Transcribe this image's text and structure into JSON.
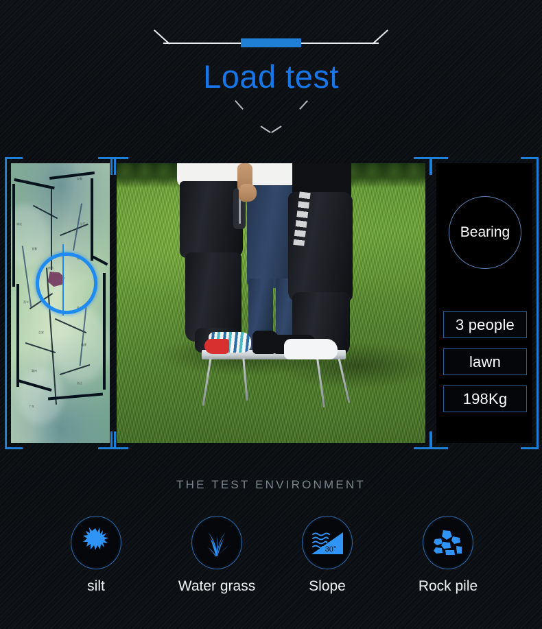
{
  "header": {
    "title": "Load test",
    "accent_color": "#1876e8",
    "rule_color": "#e8eef2"
  },
  "panels": {
    "map": {
      "name": "region-map",
      "alt": "green topographic region map with blue target ring",
      "labels": [
        "江西",
        "南昌",
        "九江",
        "吉安",
        "赣州",
        "临川",
        "乐平",
        "宜春",
        "萍乡",
        "鹰潭",
        "府河",
        "鱄鱼",
        "浙江",
        "福建"
      ]
    },
    "photo": {
      "name": "load-test-photo",
      "alt": "three people standing on a small folding camp table on lawn"
    },
    "spec": {
      "circle_label": "Bearing",
      "rows": [
        "3 people",
        "lawn",
        "198Kg"
      ]
    }
  },
  "environment": {
    "heading": "THE TEST ENVIRONMENT",
    "items": [
      {
        "label": "silt",
        "icon": "silt-icon"
      },
      {
        "label": "Water grass",
        "icon": "water-grass-icon"
      },
      {
        "label": "Slope",
        "icon": "slope-icon",
        "angle": "30°"
      },
      {
        "label": "Rock pile",
        "icon": "rock-pile-icon"
      }
    ]
  },
  "colors": {
    "accent_blue": "#1f7fd6",
    "title_blue": "#1876e8",
    "icon_blue": "#2f94f5",
    "muted_text": "#7b858c",
    "background": "#0b0e12"
  }
}
